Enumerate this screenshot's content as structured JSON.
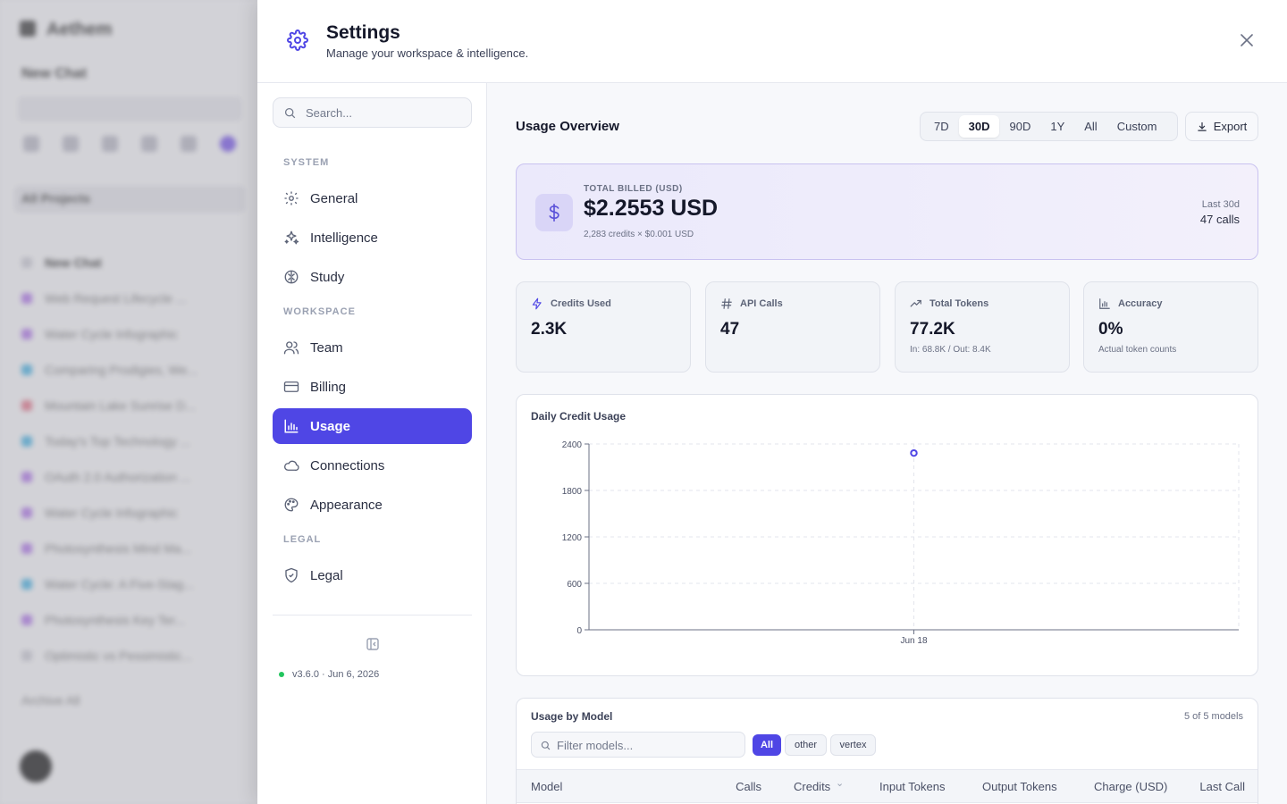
{
  "background_app": {
    "brand": "Aethem",
    "new_chat": "New Chat",
    "project": "All Projects",
    "chats": [
      "New Chat",
      "Web Request Lifecycle ...",
      "Water Cycle Infographic",
      "Comparing Prodigies, We...",
      "Mountain Lake Sunrise D...",
      "Today's Top Technology ...",
      "OAuth 2.0 Authorization ...",
      "Water Cycle Infographic",
      "Photosynthesis Mind Ma...",
      "Water Cycle: A Five-Stag...",
      "Photosynthesis Key Ter...",
      "Optimistic vs Pessimistic..."
    ],
    "archive": "Archive All"
  },
  "header": {
    "title": "Settings",
    "subtitle": "Manage your workspace & intelligence."
  },
  "nav": {
    "search_placeholder": "Search...",
    "sections": {
      "system": "SYSTEM",
      "workspace": "WORKSPACE",
      "legal": "LEGAL"
    },
    "items": {
      "general": "General",
      "intelligence": "Intelligence",
      "study": "Study",
      "team": "Team",
      "billing": "Billing",
      "usage": "Usage",
      "connections": "Connections",
      "appearance": "Appearance",
      "legal": "Legal"
    },
    "active": "usage",
    "version": "v3.6.0 · Jun 6, 2026"
  },
  "main": {
    "title": "Usage Overview",
    "ranges": [
      "7D",
      "30D",
      "90D",
      "1Y",
      "All",
      "Custom"
    ],
    "selected_range": "30D",
    "export_label": "Export",
    "billed": {
      "label": "TOTAL BILLED (USD)",
      "amount": "$2.2553 USD",
      "calc": "2,283 credits × $0.001 USD",
      "period": "Last 30d",
      "calls": "47 calls"
    },
    "stats": [
      {
        "label": "Credits Used",
        "value": "2.3K",
        "sub": ""
      },
      {
        "label": "API Calls",
        "value": "47",
        "sub": ""
      },
      {
        "label": "Total Tokens",
        "value": "77.2K",
        "sub": "In: 68.8K / Out: 8.4K"
      },
      {
        "label": "Accuracy",
        "value": "0%",
        "sub": "Actual token counts"
      }
    ],
    "chart_title": "Daily Credit Usage",
    "models": {
      "title": "Usage by Model",
      "count": "5 of 5 models",
      "filter_placeholder": "Filter models...",
      "chips": [
        "All",
        "other",
        "vertex"
      ],
      "selected_chip": "All",
      "columns": [
        "Model",
        "Calls",
        "Credits",
        "Input Tokens",
        "Output Tokens",
        "Charge (USD)",
        "Last Call"
      ]
    }
  },
  "colors": {
    "accent": "#4f46e5",
    "status_online": "#22c55e"
  },
  "chart_data": {
    "type": "scatter",
    "title": "Daily Credit Usage",
    "x": [
      "Jun 18"
    ],
    "values": [
      2283
    ],
    "ylim": [
      0,
      2400
    ],
    "yticks": [
      0,
      600,
      1200,
      1800,
      2400
    ],
    "xticks": [
      "Jun 18"
    ],
    "grid": true
  }
}
